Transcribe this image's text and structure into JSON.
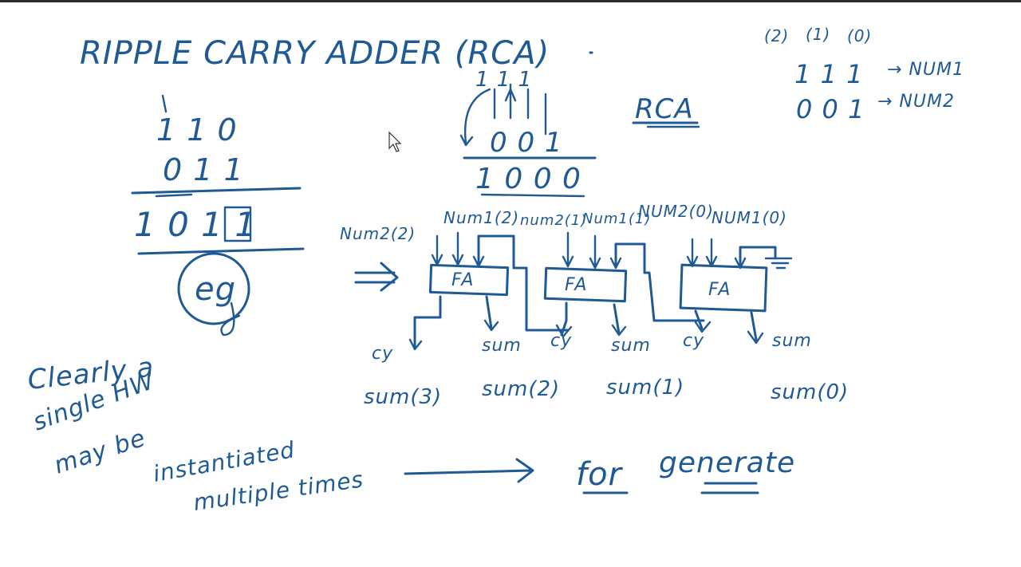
{
  "title": "RIPPLE CARRY ADDER (RCA)",
  "labels": {
    "rca": "RCA",
    "bit_idx_2": "(2)",
    "bit_idx_1": "(1)",
    "bit_idx_0": "(0)",
    "num1_bits": "1 1 1",
    "num2_bits": "0 0 1",
    "num1_label": "→ NUM1",
    "num2_label": "→ NUM2"
  },
  "left_example": {
    "carry_row": "1 1 0",
    "operand": "0 1 1",
    "result": "1 0 1 1",
    "eg": "eg"
  },
  "middle_example": {
    "carries": "1 1 1",
    "operand": "0 0 1",
    "result": "1 0 0 0"
  },
  "circuit": {
    "inputs": [
      "Num2(2)",
      "Num1(2)",
      "num2(1)",
      "Num1(1)",
      "NUM2(0)",
      "NUM1(0)"
    ],
    "blocks": [
      "FA",
      "FA",
      "FA"
    ],
    "carry_labels": [
      "cy",
      "cy",
      "cy"
    ],
    "sum_labels": [
      "sum",
      "sum",
      "sum"
    ],
    "outputs": [
      "sum(3)",
      "sum(2)",
      "sum(1)",
      "sum(0)"
    ]
  },
  "note": {
    "line1": "Clearly a",
    "line2": "single HW",
    "line3": "may be",
    "line4": "instantiated",
    "line5": "multiple times"
  },
  "conclusion": {
    "for": "for",
    "generate": "generate"
  },
  "colors": {
    "ink": "#1f5a94",
    "border": "#2b2b2b"
  }
}
